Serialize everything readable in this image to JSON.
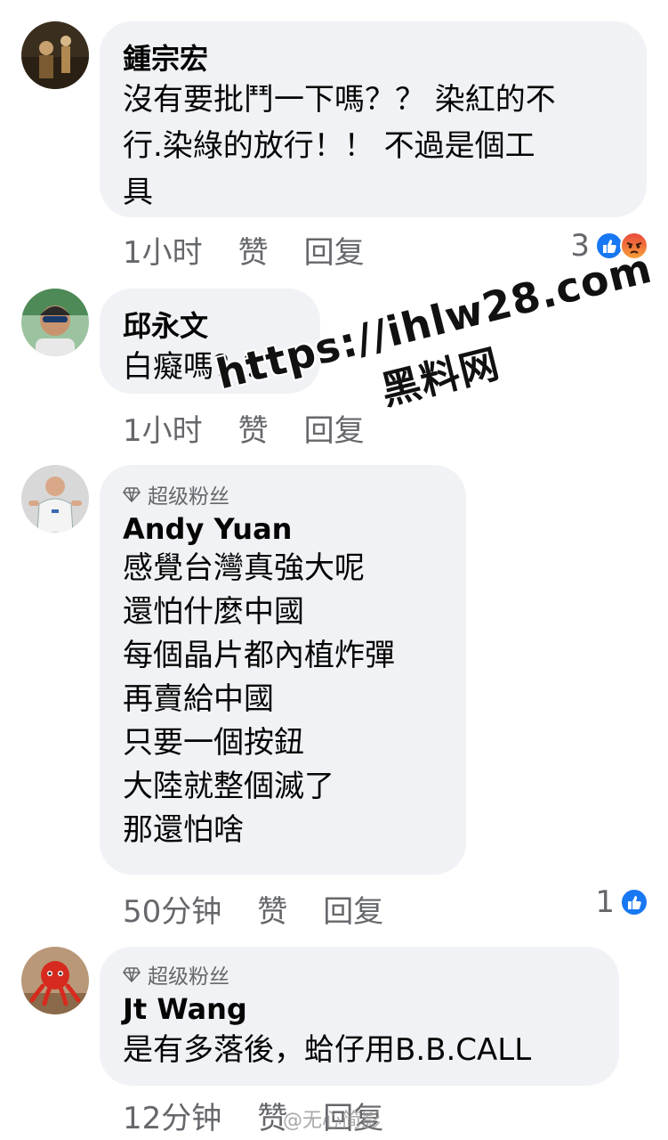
{
  "comments": [
    {
      "name": "鍾宗宏",
      "text": "沒有要批鬥一下嗎？？ 染紅的不\n行.染綠的放行！！ 不過是個工\n具",
      "time": "1小时",
      "like_label": "赞",
      "reply_label": "回复",
      "reaction_count": "3",
      "reactions": [
        "like-icon",
        "angry-icon"
      ]
    },
    {
      "name": "邱永文",
      "text": "白癡嗎？？",
      "time": "1小时",
      "like_label": "赞",
      "reply_label": "回复"
    },
    {
      "badge": "超级粉丝",
      "name": "Andy Yuan",
      "text": "感覺台灣真強大呢\n還怕什麼中國\n每個晶片都內植炸彈\n再賣給中國\n只要一個按鈕\n大陸就整個滅了\n那還怕啥",
      "time": "50分钟",
      "like_label": "赞",
      "reply_label": "回复",
      "reaction_count": "1",
      "reactions": [
        "like-icon"
      ]
    },
    {
      "badge": "超级粉丝",
      "name": "Jt Wang",
      "text": "是有多落後，蛤仔用B.B.CALL",
      "time": "12分钟",
      "like_label": "赞",
      "reply_label": "回复"
    }
  ],
  "watermark": {
    "url": "https://ihlw28.com",
    "sub": "黑料网"
  },
  "source_mark": "@无心简影",
  "colors": {
    "bubble": "#f0f2f5",
    "meta_text": "#65676b",
    "like_blue": "#1877f2",
    "angry_orange": "#f7714c"
  }
}
